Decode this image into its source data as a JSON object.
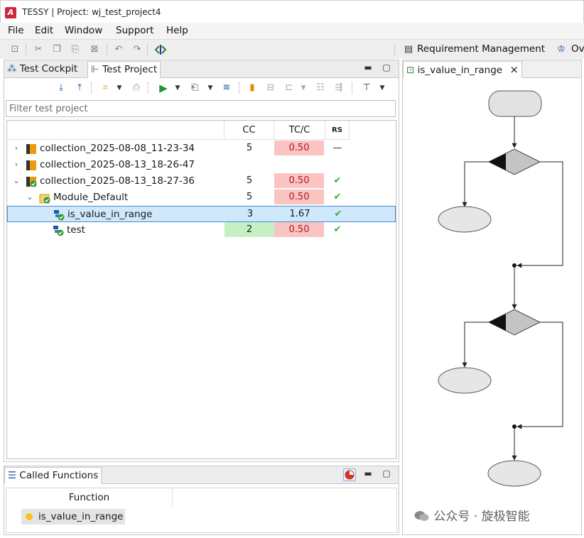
{
  "window": {
    "title": "TESSY | Project: wj_test_project4",
    "logo_glyph": "A"
  },
  "menu": [
    "File",
    "Edit",
    "Window",
    "Support",
    "Help"
  ],
  "toolbar": {
    "requirement_management": "Requirement Management",
    "overflow_label": "Ov"
  },
  "left_panel": {
    "tabs": [
      {
        "label": "Test Cockpit",
        "active": false
      },
      {
        "label": "Test Project",
        "active": true
      }
    ],
    "filter_placeholder": "Filter test project",
    "columns": {
      "cc": "CC",
      "tcc": "TC/C",
      "rs": "RS"
    },
    "rows": [
      {
        "name": "collection_2025-08-08_11-23-34",
        "twisty": "›",
        "indent": 0,
        "icon": "collection-icon",
        "cc": "5",
        "tcc": "0.50",
        "tcc_state": "red",
        "rs": "—",
        "rs_state": "dash"
      },
      {
        "name": "collection_2025-08-13_18-26-47",
        "twisty": "›",
        "indent": 0,
        "icon": "collection-icon",
        "cc": "",
        "tcc": "",
        "tcc_state": "",
        "rs": "",
        "rs_state": ""
      },
      {
        "name": "collection_2025-08-13_18-27-36",
        "twisty": "⌄",
        "indent": 0,
        "icon": "collection-ok-icon",
        "cc": "5",
        "tcc": "0.50",
        "tcc_state": "red",
        "rs": "✔",
        "rs_state": "ok"
      },
      {
        "name": "Module_Default",
        "twisty": "⌄",
        "indent": 1,
        "icon": "module-ok-icon",
        "cc": "5",
        "tcc": "0.50",
        "tcc_state": "red",
        "rs": "✔",
        "rs_state": "ok"
      },
      {
        "name": "is_value_in_range",
        "twisty": "",
        "indent": 2,
        "icon": "test-object-ok-icon",
        "cc": "3",
        "tcc": "1.67",
        "tcc_state": "",
        "rs": "✔",
        "rs_state": "ok",
        "selected": true
      },
      {
        "name": "test",
        "twisty": "",
        "indent": 2,
        "icon": "test-object-ok-icon",
        "cc": "2",
        "cc_state": "green",
        "tcc": "0.50",
        "tcc_state": "red",
        "rs": "✔",
        "rs_state": "ok"
      }
    ]
  },
  "bottom_panel": {
    "tab": "Called Functions",
    "column": "Function",
    "items": [
      {
        "name": "is_value_in_range",
        "dot_color": "#f5c518"
      }
    ]
  },
  "right_panel": {
    "tab": "is_value_in_range",
    "close_glyph": "×"
  },
  "watermark": "公众号 · 旋极智能",
  "colors": {
    "red_cell": "#f9c4c2",
    "red_text": "#b01818",
    "green_cell": "#c4f0c4",
    "check": "#3fa83f",
    "selected": "#cfe8fb",
    "selected_border": "#4a90d0"
  }
}
